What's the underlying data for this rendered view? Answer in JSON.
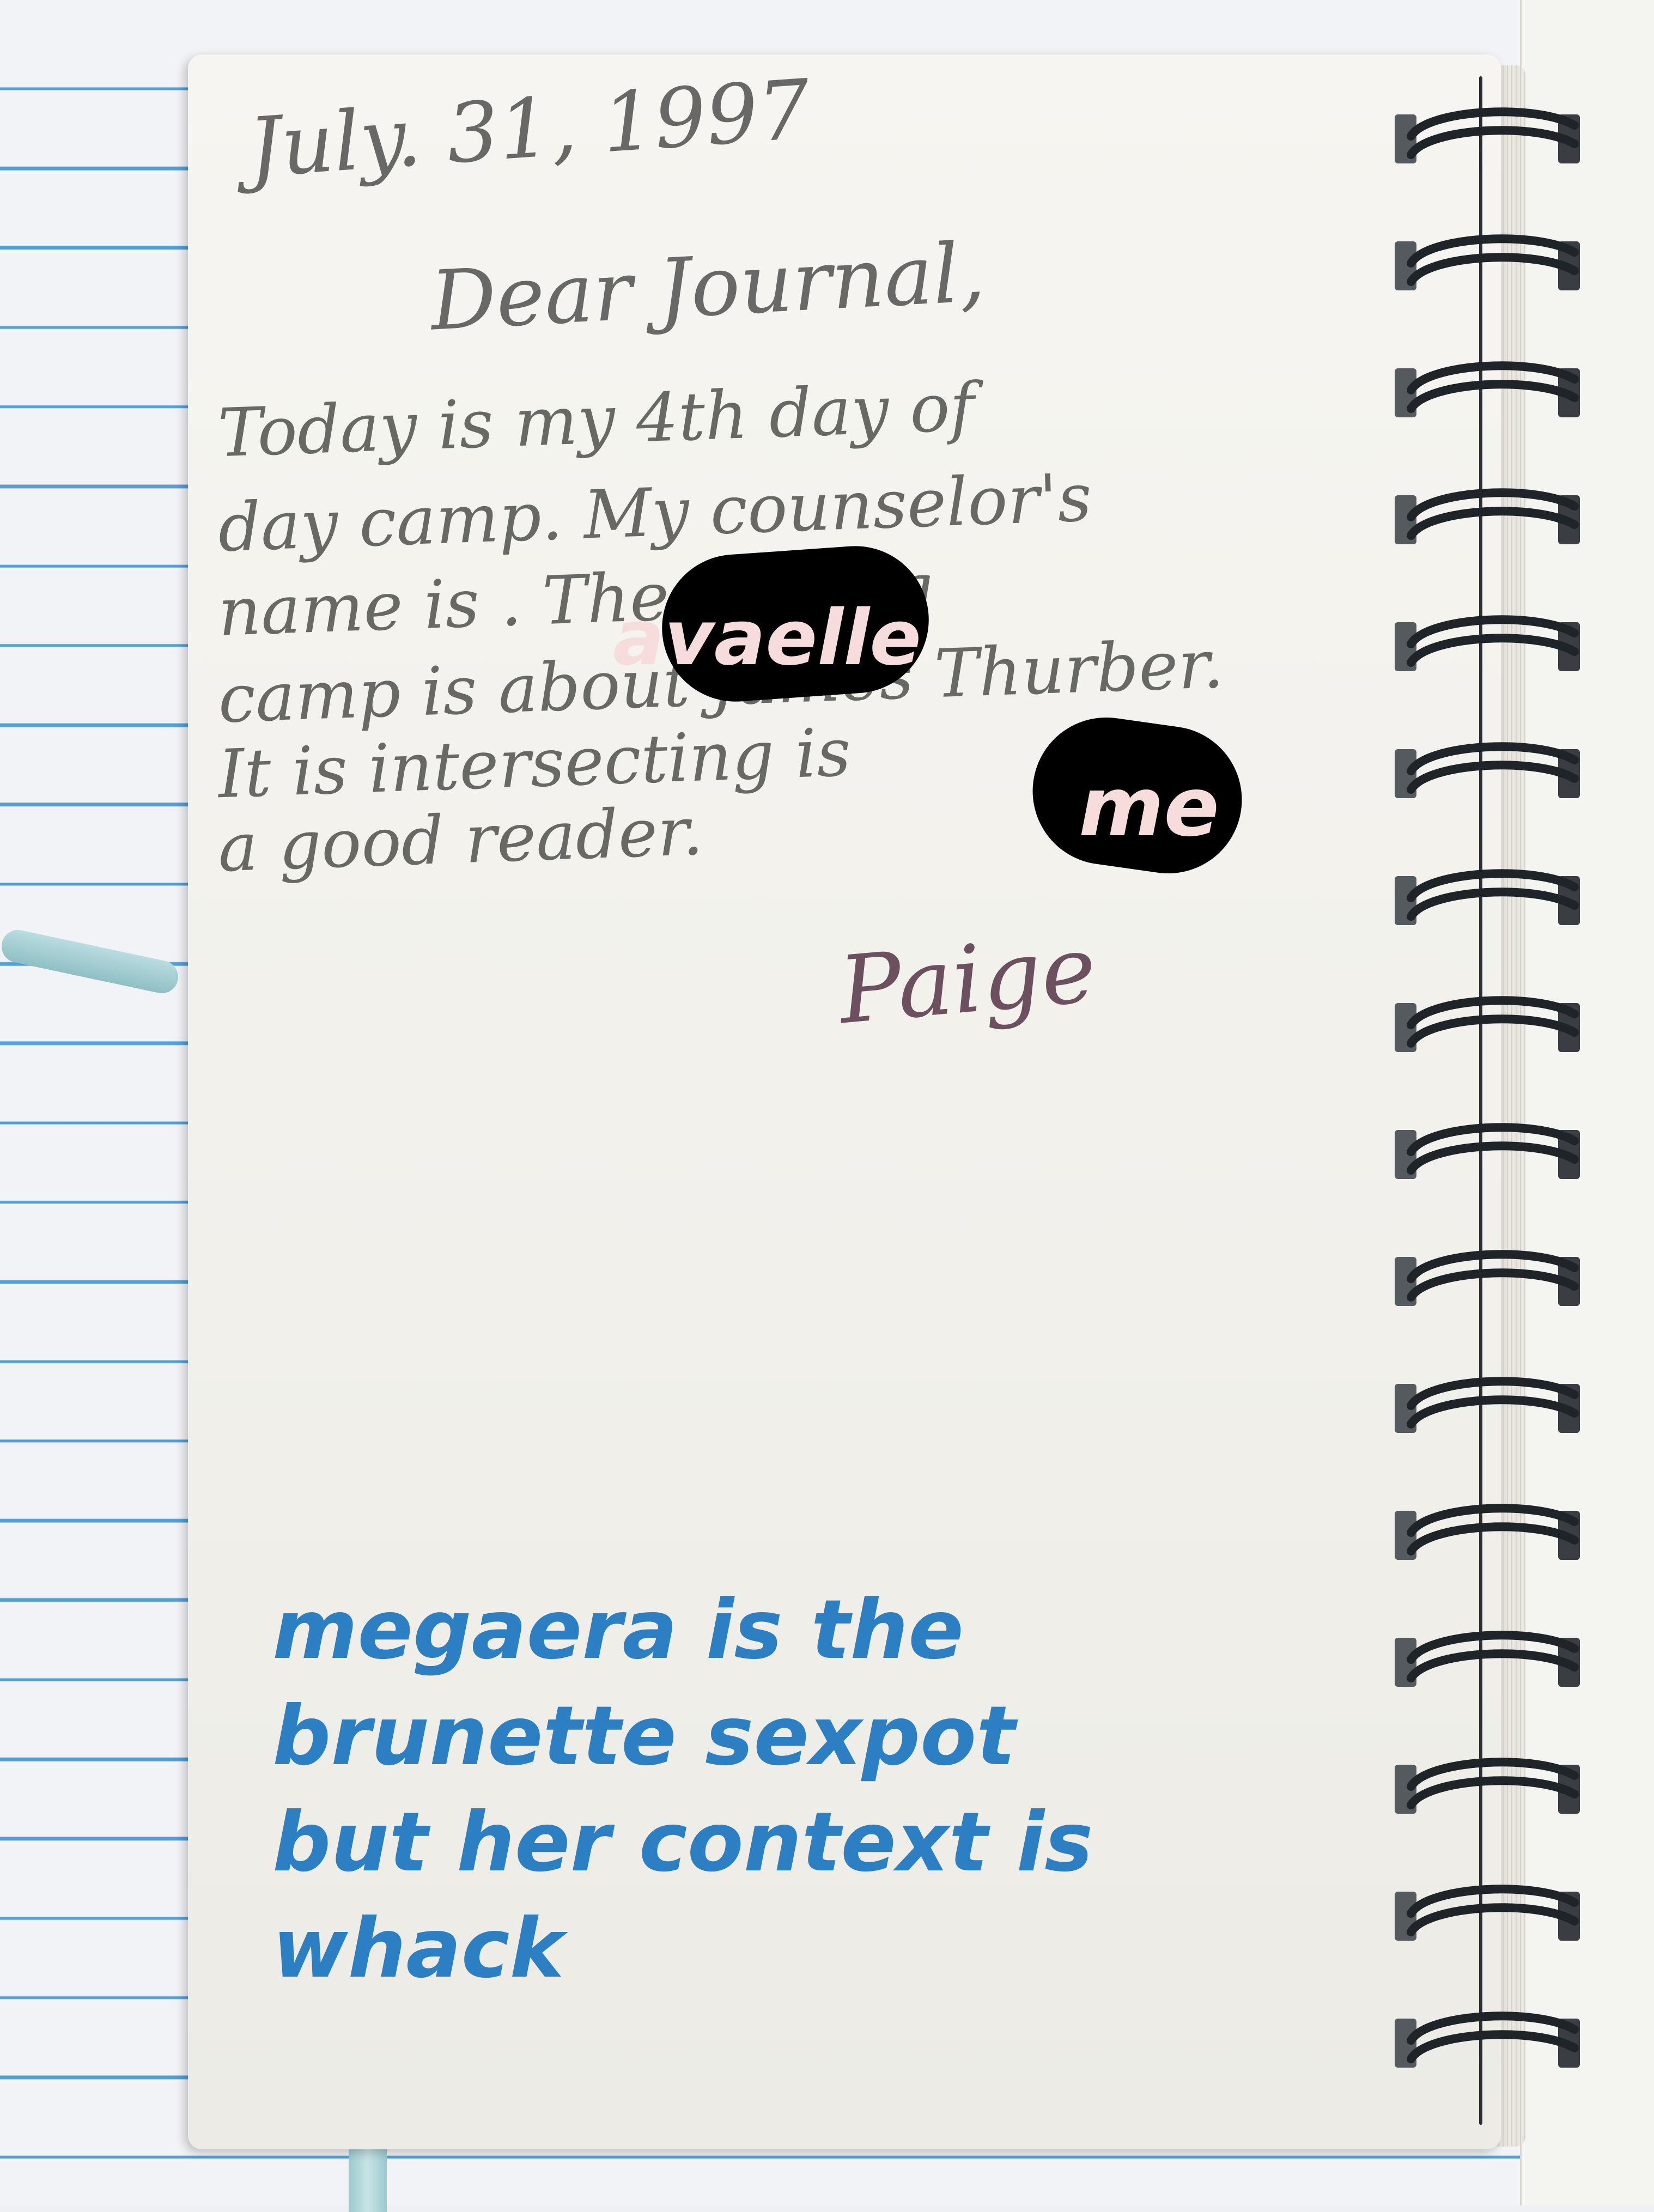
{
  "journal": {
    "date": "July. 31, 1997",
    "greeting": "Dear Journal,",
    "body_lines": [
      "Today is my 4th day of",
      "day camp. My counselor's",
      "name is            . The writing",
      "camp is about James Thurber.",
      "It is intersecting           is",
      "a good reader."
    ],
    "signature": "Paige"
  },
  "overlay_labels": [
    "avaelle",
    "me"
  ],
  "caption_lines": [
    "megaera is the",
    "brunette sexpot",
    "but her context is",
    "whack"
  ],
  "colors": {
    "caption": "#2b7fc2",
    "overlay_text": "#f7dcdc",
    "redaction": "#000000",
    "pencil": "#555553",
    "signature_ink": "#5a3a4c",
    "paper_lines": "#4f9fd8"
  }
}
